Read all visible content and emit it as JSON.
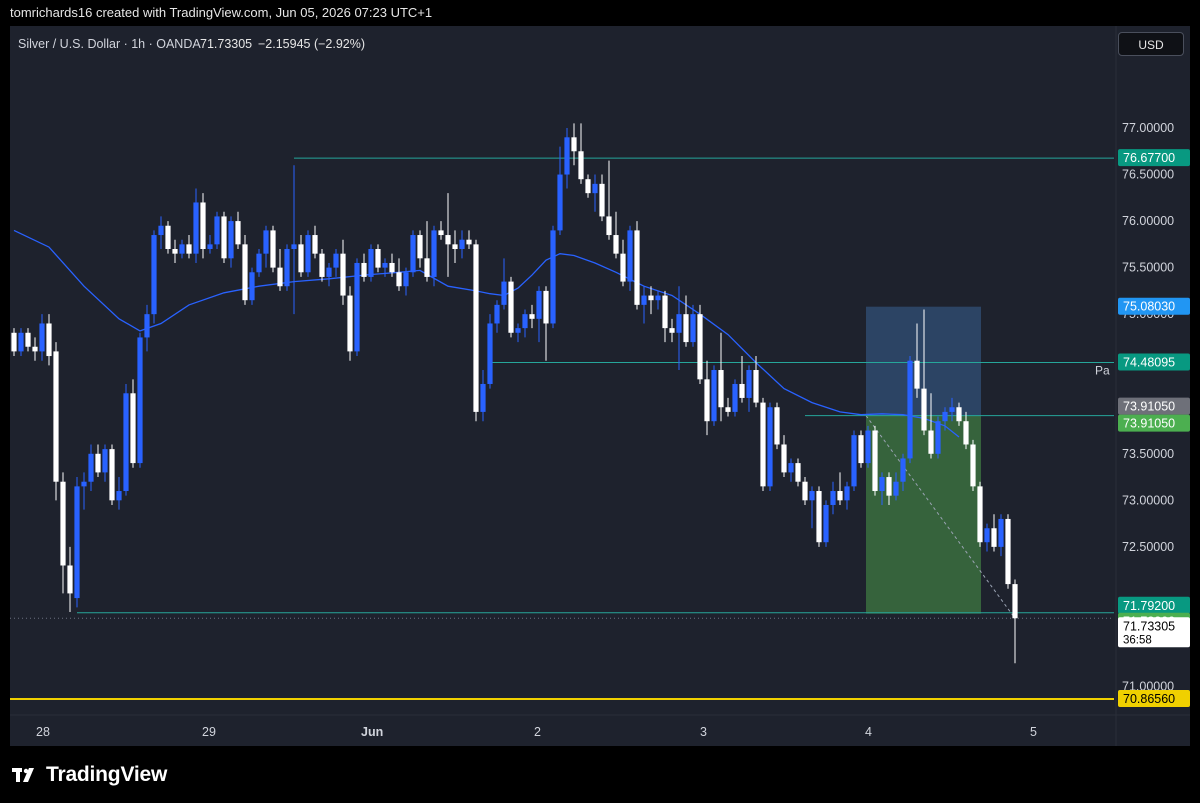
{
  "header": {
    "attribution": "tomrichards16 created with TradingView.com, Jun 05, 2026 07:23 UTC+1"
  },
  "legend": {
    "symbol": "Silver / U.S. Dollar · 1h · OANDA",
    "price": "71.73305",
    "change": "−2.15945 (−2.92%)"
  },
  "currency_button": "USD",
  "brand": {
    "name": "TradingView",
    "icon": "tradingview-logo-icon"
  },
  "colors": {
    "background": "#1e222d",
    "bull": "#2962ff",
    "bear": "#ffffff",
    "ma": "#2962ff",
    "level_line": "#26a69a",
    "support_line": "#f0d000",
    "stop_zone": "#2f4a6e",
    "target_zone": "#3b6e3f"
  },
  "chart_data": {
    "type": "candlestick",
    "symbol": "Silver / U.S. Dollar",
    "interval": "1h",
    "exchange": "OANDA",
    "ylim": [
      70.75,
      77.45
    ],
    "y_ticks": [
      "77.00000",
      "76.50000",
      "76.00000",
      "75.50000",
      "75.00000",
      "74.50000",
      "73.50000",
      "73.00000",
      "72.50000",
      "71.50000",
      "71.00000"
    ],
    "x_ticks": [
      "28",
      "29",
      "Jun",
      "2",
      "3",
      "4",
      "5"
    ],
    "price_tags": [
      {
        "label": "76.67700",
        "value": 76.677,
        "color": "#089981"
      },
      {
        "label": "75.08030",
        "value": 75.0803,
        "color": "#2196f3"
      },
      {
        "label": "74.48095",
        "value": 74.48095,
        "color": "#089981"
      },
      {
        "label": "73.91050",
        "value": 73.9105,
        "color": "#6e7079"
      },
      {
        "label": "73.91050",
        "value": 73.9105,
        "color": "#4caf50"
      },
      {
        "label": "71.79200",
        "value": 71.792,
        "color": "#089981"
      },
      {
        "label": "71.78200",
        "value": 71.782,
        "color": "#4caf50"
      },
      {
        "label": "70.86560",
        "value": 70.8656,
        "color": "#f0d000"
      }
    ],
    "current_price": {
      "label": "71.73305",
      "countdown": "36:58",
      "value": 71.73305
    },
    "drawing_label": "Pa",
    "horizontal_levels": [
      {
        "name": "resistance-76-677",
        "value": 76.677,
        "from_bar": 40
      },
      {
        "name": "level-74-48095",
        "value": 74.48095,
        "from_bar": 68
      },
      {
        "name": "entry-73-9105",
        "value": 73.9105,
        "from_bar": 113
      },
      {
        "name": "low-71-792",
        "value": 71.792,
        "from_bar": 9
      },
      {
        "name": "support-70-8656",
        "value": 70.8656,
        "from_bar": 0
      }
    ],
    "position_tool": {
      "entry": 73.9105,
      "stop": 75.0803,
      "target": 71.782,
      "from_bar": 122,
      "to_bar": 137
    },
    "ma": [
      [
        0,
        75.9
      ],
      [
        5,
        75.72
      ],
      [
        10,
        75.3
      ],
      [
        15,
        74.95
      ],
      [
        18,
        74.82
      ],
      [
        21,
        74.9
      ],
      [
        25,
        75.1
      ],
      [
        30,
        75.23
      ],
      [
        35,
        75.3
      ],
      [
        40,
        75.35
      ],
      [
        45,
        75.38
      ],
      [
        50,
        75.42
      ],
      [
        55,
        75.45
      ],
      [
        58,
        75.47
      ],
      [
        62,
        75.3
      ],
      [
        66,
        75.25
      ],
      [
        68,
        75.22
      ],
      [
        70,
        75.2
      ],
      [
        72,
        75.28
      ],
      [
        74,
        75.42
      ],
      [
        76,
        75.58
      ],
      [
        78,
        75.65
      ],
      [
        80,
        75.63
      ],
      [
        83,
        75.55
      ],
      [
        86,
        75.45
      ],
      [
        90,
        75.3
      ],
      [
        94,
        75.2
      ],
      [
        98,
        75.0
      ],
      [
        102,
        74.78
      ],
      [
        106,
        74.48
      ],
      [
        110,
        74.2
      ],
      [
        114,
        74.05
      ],
      [
        118,
        73.95
      ],
      [
        121,
        73.92
      ],
      [
        124,
        73.93
      ],
      [
        127,
        73.92
      ],
      [
        130,
        73.88
      ],
      [
        133,
        73.8
      ],
      [
        135,
        73.68
      ]
    ],
    "candles": [
      [
        74.8,
        74.85,
        74.55,
        74.6
      ],
      [
        74.6,
        74.85,
        74.55,
        74.8
      ],
      [
        74.8,
        74.85,
        74.6,
        74.65
      ],
      [
        74.65,
        74.75,
        74.5,
        74.6
      ],
      [
        74.6,
        75.0,
        74.5,
        74.9
      ],
      [
        74.9,
        75.0,
        74.45,
        74.55
      ],
      [
        74.6,
        74.7,
        73.0,
        73.2
      ],
      [
        73.2,
        73.3,
        72.0,
        72.3
      ],
      [
        72.3,
        72.5,
        71.8,
        72.0
      ],
      [
        71.95,
        73.25,
        71.85,
        73.15
      ],
      [
        73.15,
        73.3,
        72.9,
        73.2
      ],
      [
        73.2,
        73.6,
        73.1,
        73.5
      ],
      [
        73.5,
        73.6,
        73.25,
        73.3
      ],
      [
        73.3,
        73.6,
        73.2,
        73.55
      ],
      [
        73.55,
        73.6,
        72.95,
        73.0
      ],
      [
        73.0,
        73.25,
        72.9,
        73.1
      ],
      [
        73.1,
        74.25,
        73.05,
        74.15
      ],
      [
        74.15,
        74.3,
        73.35,
        73.4
      ],
      [
        73.4,
        74.8,
        73.35,
        74.75
      ],
      [
        74.75,
        75.1,
        74.6,
        75.0
      ],
      [
        75.0,
        75.9,
        74.9,
        75.85
      ],
      [
        75.85,
        76.05,
        75.7,
        75.95
      ],
      [
        75.95,
        76.0,
        75.65,
        75.7
      ],
      [
        75.7,
        75.8,
        75.55,
        75.65
      ],
      [
        75.65,
        75.8,
        75.6,
        75.75
      ],
      [
        75.75,
        75.85,
        75.6,
        75.65
      ],
      [
        75.65,
        76.35,
        75.55,
        76.2
      ],
      [
        76.2,
        76.3,
        75.6,
        75.7
      ],
      [
        75.7,
        75.85,
        75.65,
        75.75
      ],
      [
        75.75,
        76.1,
        75.7,
        76.05
      ],
      [
        76.05,
        76.1,
        75.55,
        75.6
      ],
      [
        75.6,
        76.05,
        75.5,
        76.0
      ],
      [
        76.0,
        76.1,
        75.7,
        75.75
      ],
      [
        75.75,
        75.85,
        75.1,
        75.15
      ],
      [
        75.15,
        75.5,
        75.1,
        75.45
      ],
      [
        75.45,
        75.7,
        75.4,
        75.65
      ],
      [
        75.65,
        75.95,
        75.5,
        75.9
      ],
      [
        75.9,
        75.95,
        75.45,
        75.5
      ],
      [
        75.5,
        75.7,
        75.25,
        75.3
      ],
      [
        75.3,
        75.75,
        75.25,
        75.7
      ],
      [
        75.7,
        76.6,
        75.0,
        75.75
      ],
      [
        75.75,
        75.85,
        75.4,
        75.45
      ],
      [
        75.45,
        75.9,
        75.4,
        75.85
      ],
      [
        75.85,
        75.95,
        75.6,
        75.65
      ],
      [
        75.65,
        75.7,
        75.35,
        75.4
      ],
      [
        75.4,
        75.55,
        75.3,
        75.5
      ],
      [
        75.5,
        75.7,
        75.4,
        75.65
      ],
      [
        75.65,
        75.8,
        75.1,
        75.2
      ],
      [
        75.2,
        75.3,
        74.5,
        74.6
      ],
      [
        74.6,
        75.6,
        74.55,
        75.55
      ],
      [
        75.55,
        75.65,
        75.35,
        75.4
      ],
      [
        75.4,
        75.75,
        75.35,
        75.7
      ],
      [
        75.7,
        75.75,
        75.45,
        75.5
      ],
      [
        75.5,
        75.6,
        75.4,
        75.55
      ],
      [
        75.55,
        75.65,
        75.4,
        75.45
      ],
      [
        75.45,
        75.6,
        75.25,
        75.3
      ],
      [
        75.3,
        75.5,
        75.2,
        75.45
      ],
      [
        75.45,
        75.9,
        75.4,
        75.85
      ],
      [
        75.85,
        75.9,
        75.5,
        75.6
      ],
      [
        75.6,
        76.0,
        75.35,
        75.4
      ],
      [
        75.4,
        75.95,
        75.3,
        75.9
      ],
      [
        75.9,
        76.0,
        75.8,
        75.85
      ],
      [
        75.85,
        76.3,
        75.4,
        75.75
      ],
      [
        75.75,
        75.9,
        75.55,
        75.7
      ],
      [
        75.7,
        75.9,
        75.6,
        75.8
      ],
      [
        75.8,
        75.9,
        75.7,
        75.75
      ],
      [
        75.75,
        75.8,
        73.85,
        73.95
      ],
      [
        73.95,
        74.4,
        73.85,
        74.25
      ],
      [
        74.25,
        75.0,
        74.2,
        74.9
      ],
      [
        74.9,
        75.15,
        74.8,
        75.1
      ],
      [
        75.1,
        75.6,
        75.05,
        75.35
      ],
      [
        75.35,
        75.4,
        74.75,
        74.8
      ],
      [
        74.8,
        74.9,
        74.7,
        74.85
      ],
      [
        74.85,
        75.05,
        74.75,
        75.0
      ],
      [
        75.0,
        75.1,
        74.85,
        74.95
      ],
      [
        74.95,
        75.3,
        74.7,
        75.25
      ],
      [
        75.25,
        75.3,
        74.5,
        74.9
      ],
      [
        74.9,
        75.95,
        74.85,
        75.9
      ],
      [
        75.9,
        76.8,
        75.85,
        76.5
      ],
      [
        76.5,
        77.0,
        76.35,
        76.9
      ],
      [
        76.9,
        77.05,
        76.6,
        76.75
      ],
      [
        76.75,
        77.05,
        76.4,
        76.45
      ],
      [
        76.45,
        76.5,
        76.25,
        76.3
      ],
      [
        76.3,
        76.5,
        76.1,
        76.4
      ],
      [
        76.4,
        76.5,
        76.0,
        76.05
      ],
      [
        76.05,
        76.65,
        75.8,
        75.85
      ],
      [
        75.85,
        76.1,
        75.6,
        75.65
      ],
      [
        75.65,
        75.8,
        75.3,
        75.35
      ],
      [
        75.35,
        75.95,
        75.25,
        75.9
      ],
      [
        75.9,
        76.0,
        75.05,
        75.1
      ],
      [
        75.1,
        75.3,
        74.9,
        75.2
      ],
      [
        75.2,
        75.3,
        75.0,
        75.15
      ],
      [
        75.15,
        75.25,
        75.05,
        75.2
      ],
      [
        75.2,
        75.25,
        74.7,
        74.85
      ],
      [
        74.85,
        74.95,
        74.7,
        74.8
      ],
      [
        74.8,
        75.3,
        74.4,
        75.0
      ],
      [
        75.0,
        75.2,
        74.65,
        74.7
      ],
      [
        74.7,
        75.1,
        74.65,
        75.0
      ],
      [
        75.0,
        75.1,
        74.25,
        74.3
      ],
      [
        74.3,
        74.5,
        73.7,
        73.85
      ],
      [
        73.85,
        74.45,
        73.8,
        74.4
      ],
      [
        74.4,
        74.8,
        73.85,
        74.0
      ],
      [
        74.0,
        74.1,
        73.9,
        73.95
      ],
      [
        73.95,
        74.3,
        73.9,
        74.25
      ],
      [
        74.25,
        74.55,
        74.05,
        74.1
      ],
      [
        74.1,
        74.45,
        73.95,
        74.4
      ],
      [
        74.4,
        74.55,
        74.0,
        74.05
      ],
      [
        74.05,
        74.1,
        73.1,
        73.15
      ],
      [
        73.15,
        74.05,
        73.1,
        74.0
      ],
      [
        74.0,
        74.05,
        73.55,
        73.6
      ],
      [
        73.6,
        73.7,
        73.25,
        73.3
      ],
      [
        73.3,
        73.45,
        73.2,
        73.4
      ],
      [
        73.4,
        73.45,
        73.15,
        73.2
      ],
      [
        73.2,
        73.25,
        72.95,
        73.0
      ],
      [
        73.0,
        73.15,
        72.7,
        73.1
      ],
      [
        73.1,
        73.15,
        72.5,
        72.55
      ],
      [
        72.55,
        73.0,
        72.5,
        72.95
      ],
      [
        72.95,
        73.2,
        72.85,
        73.1
      ],
      [
        73.1,
        73.3,
        72.95,
        73.0
      ],
      [
        73.0,
        73.2,
        72.9,
        73.15
      ],
      [
        73.15,
        73.75,
        73.1,
        73.7
      ],
      [
        73.7,
        73.75,
        73.35,
        73.4
      ],
      [
        73.4,
        73.8,
        73.35,
        73.75
      ],
      [
        73.75,
        73.8,
        73.05,
        73.1
      ],
      [
        73.1,
        73.3,
        72.95,
        73.25
      ],
      [
        73.25,
        73.3,
        72.95,
        73.05
      ],
      [
        73.05,
        73.3,
        73.0,
        73.2
      ],
      [
        73.2,
        73.5,
        73.1,
        73.45
      ],
      [
        73.45,
        74.55,
        73.4,
        74.5
      ],
      [
        74.5,
        74.9,
        74.1,
        74.2
      ],
      [
        74.2,
        75.05,
        73.7,
        73.75
      ],
      [
        73.75,
        74.15,
        73.45,
        73.5
      ],
      [
        73.5,
        73.9,
        73.45,
        73.85
      ],
      [
        73.85,
        74.0,
        73.75,
        73.95
      ],
      [
        73.95,
        74.1,
        73.85,
        74.0
      ],
      [
        74.0,
        74.05,
        73.8,
        73.85
      ]
    ],
    "tail_candles": [
      [
        73.85,
        73.95,
        73.55,
        73.6
      ],
      [
        73.6,
        73.65,
        73.1,
        73.15
      ],
      [
        73.15,
        73.2,
        72.5,
        72.55
      ],
      [
        72.55,
        72.75,
        72.45,
        72.7
      ],
      [
        72.7,
        72.85,
        72.45,
        72.5
      ],
      [
        72.5,
        72.85,
        72.4,
        72.8
      ],
      [
        72.8,
        72.85,
        72.05,
        72.1
      ],
      [
        72.1,
        72.15,
        71.25,
        71.73305
      ]
    ]
  }
}
